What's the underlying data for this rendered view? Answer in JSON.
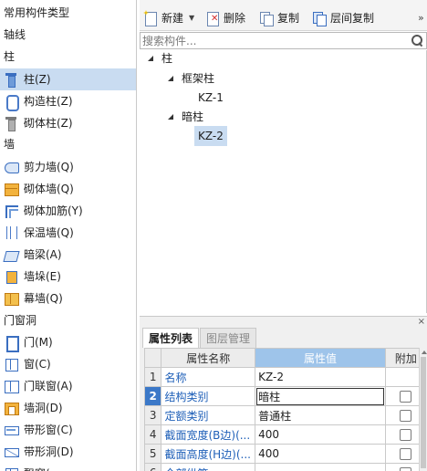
{
  "left_panel": {
    "groups": [
      {
        "label": "常用构件类型"
      },
      {
        "label": "轴线"
      },
      {
        "label": "柱"
      },
      {
        "label": "墙"
      },
      {
        "label": "门窗洞"
      }
    ],
    "items": [
      {
        "label": "柱(Z)",
        "icon": "column-icon",
        "selected": true
      },
      {
        "label": "构造柱(Z)",
        "icon": "constructional-column-icon"
      },
      {
        "label": "砌体柱(Z)",
        "icon": "masonry-column-icon"
      },
      {
        "label": "剪力墙(Q)",
        "icon": "shear-wall-icon"
      },
      {
        "label": "砌体墙(Q)",
        "icon": "masonry-wall-icon"
      },
      {
        "label": "砌体加筋(Y)",
        "icon": "masonry-rebar-icon"
      },
      {
        "label": "保温墙(Q)",
        "icon": "insulation-wall-icon"
      },
      {
        "label": "暗梁(A)",
        "icon": "hidden-beam-icon"
      },
      {
        "label": "墙垛(E)",
        "icon": "wall-pier-icon"
      },
      {
        "label": "幕墙(Q)",
        "icon": "curtain-wall-icon"
      },
      {
        "label": "门(M)",
        "icon": "door-icon"
      },
      {
        "label": "窗(C)",
        "icon": "window-icon"
      },
      {
        "label": "门联窗(A)",
        "icon": "door-window-icon"
      },
      {
        "label": "墙洞(D)",
        "icon": "wall-opening-icon"
      },
      {
        "label": "带形窗(C)",
        "icon": "strip-window-icon"
      },
      {
        "label": "带形洞(D)",
        "icon": "strip-opening-icon"
      },
      {
        "label": "飘窗(..."
      }
    ]
  },
  "toolbar": {
    "new_label": "新建",
    "delete_label": "删除",
    "copy_label": "复制",
    "floor_copy_label": "层间复制",
    "more_label": "»"
  },
  "search": {
    "placeholder": "搜索构件..."
  },
  "component_tree": {
    "root": "柱",
    "nodes": [
      {
        "label": "框架柱",
        "children": [
          "KZ-1"
        ]
      },
      {
        "label": "暗柱",
        "children": [
          "KZ-2"
        ]
      }
    ]
  },
  "properties": {
    "close_label": "×",
    "tabs": [
      {
        "label": "属性列表",
        "active": true
      },
      {
        "label": "图层管理",
        "active": false
      }
    ],
    "columns": [
      "属性名称",
      "属性值",
      "附加"
    ],
    "rows": [
      {
        "num": "1",
        "name": "名称",
        "value": "KZ-2",
        "checkbox": false
      },
      {
        "num": "2",
        "name": "结构类别",
        "value": "暗柱",
        "checkbox": true,
        "selected": true
      },
      {
        "num": "3",
        "name": "定额类别",
        "value": "普通柱",
        "checkbox": true
      },
      {
        "num": "4",
        "name": "截面宽度(B边)(...",
        "value": "400",
        "checkbox": true
      },
      {
        "num": "5",
        "name": "截面高度(H边)(...",
        "value": "400",
        "checkbox": true
      },
      {
        "num": "6",
        "name": "全部纵筋",
        "value": "",
        "checkbox": true
      }
    ]
  }
}
